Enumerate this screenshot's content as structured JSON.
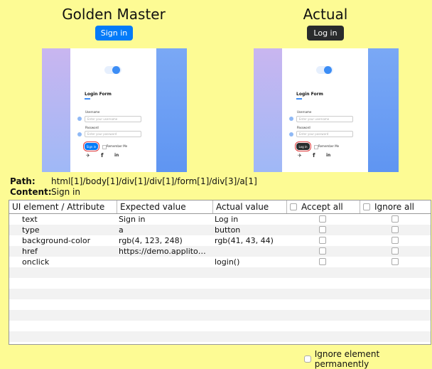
{
  "golden": {
    "title": "Golden Master",
    "button_label": "Sign in",
    "button_color": "#047bf8",
    "form_title": "Login Form",
    "username_label": "Username",
    "username_placeholder": "Enter your username",
    "password_label": "Password",
    "password_placeholder": "Enter your password",
    "signin_label": "Sign in",
    "remember_label": "Remember Me"
  },
  "actual": {
    "title": "Actual",
    "button_label": "Log in",
    "button_color": "#292b2c",
    "form_title": "Login Form",
    "username_label": "Username",
    "username_placeholder": "Enter your username",
    "password_label": "Password",
    "password_placeholder": "Enter your password",
    "login_label": "Log in",
    "remember_label": "Remember Me"
  },
  "info": {
    "path_label": "Path:",
    "path_value": "html[1]/body[1]/div[1]/div[1]/form[1]/div[3]/a[1]",
    "content_label": "Content:",
    "content_value": "Sign in"
  },
  "table": {
    "headers": {
      "element": "UI element / Attribute",
      "expected": "Expected value",
      "actual": "Actual value",
      "accept_all": "Accept all",
      "ignore_all": "Ignore all"
    },
    "rows": [
      {
        "attr": "text",
        "expected": "Sign in",
        "actual": "Log in"
      },
      {
        "attr": "type",
        "expected": "a",
        "actual": "button"
      },
      {
        "attr": "background-color",
        "expected": "rgb(4, 123, 248)",
        "actual": "rgb(41, 43, 44)"
      },
      {
        "attr": "href",
        "expected": "https://demo.applito…",
        "actual": ""
      },
      {
        "attr": "onclick",
        "expected": "",
        "actual": "login()"
      }
    ]
  },
  "footer": {
    "ignore_permanently": "Ignore element permanently"
  },
  "icons": [
    "twitter-icon",
    "facebook-icon",
    "linkedin-icon",
    "user-icon",
    "fingerprint-icon",
    "checkbox-icon"
  ]
}
